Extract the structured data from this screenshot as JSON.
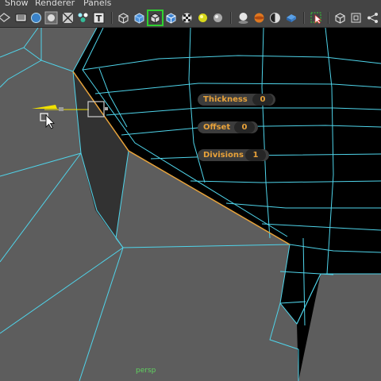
{
  "menu": [
    "Show",
    "Renderer",
    "Panels"
  ],
  "toolbar": {
    "icons": [
      "select-camera-icon",
      "camera-attributes-icon",
      "bookmark-icon",
      "image-plane-icon",
      "grid-icon",
      "film-gate-icon",
      "resolution-gate-icon",
      "field-chart-icon",
      "safe-title-icon",
      "wireframe-icon",
      "smooth-shade-icon",
      "wireframe-on-shaded-icon",
      "xray-icon",
      "texture-icon",
      "default-lighting-icon",
      "all-lights-icon",
      "shadows-icon",
      "ambient-occlusion-icon",
      "antialias-icon",
      "depth-of-field-icon",
      "isolate-select-icon",
      "xray-joints-icon",
      "xray-active-icon",
      "component-mode-icon"
    ]
  },
  "tool_fields": [
    {
      "label": "Thickness",
      "value": "0"
    },
    {
      "label": "Offset",
      "value": "0"
    },
    {
      "label": "Divisions",
      "value": "1"
    }
  ],
  "viewport": {
    "camera_label": "persp",
    "background_color": "#000000",
    "mesh_color": "#5d5d5d",
    "wire_color": "#4fd4ea",
    "selection_color": "#e8a23a"
  }
}
